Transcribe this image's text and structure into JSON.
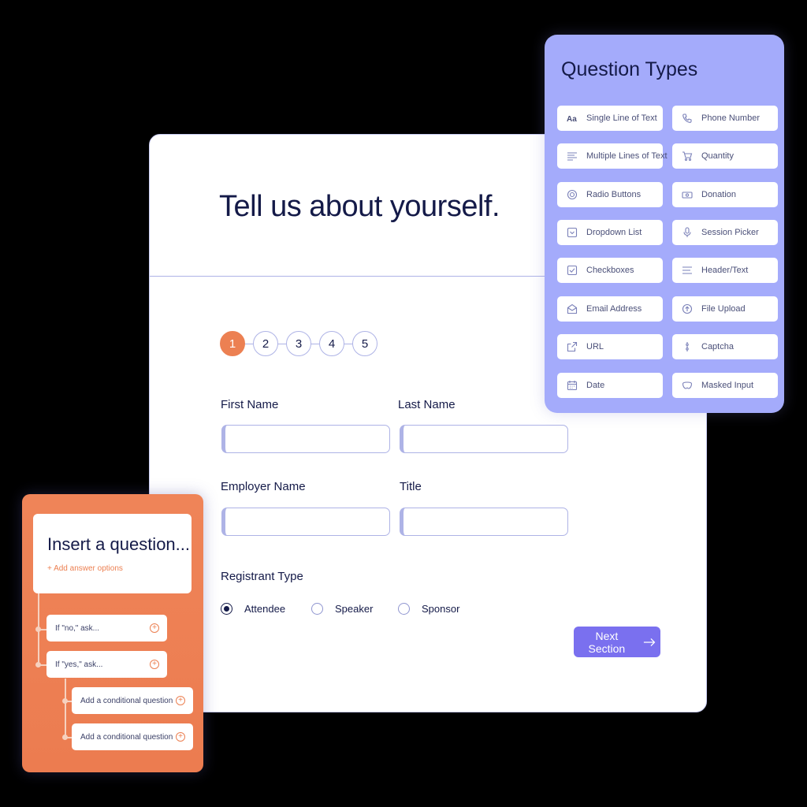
{
  "form": {
    "title": "Tell us about yourself.",
    "steps": [
      "1",
      "2",
      "3",
      "4",
      "5"
    ],
    "active_step": "1",
    "fields": {
      "first_name_label": "First Name",
      "last_name_label": "Last Name",
      "employer_name_label": "Employer Name",
      "title_label": "Title"
    },
    "registrant_type": {
      "label": "Registrant Type",
      "options": [
        "Attendee",
        "Speaker",
        "Sponsor"
      ],
      "selected": "Attendee"
    },
    "next_button_label": "Next Section",
    "colors": {
      "accent": "#7a70ef",
      "active_step": "#ec8052",
      "border": "#aeb3e6",
      "text": "#141a48"
    }
  },
  "question_types": {
    "title": "Question Types",
    "items": [
      {
        "label": "Single Line of Text",
        "icon": "text-aa-icon"
      },
      {
        "label": "Phone Number",
        "icon": "phone-icon"
      },
      {
        "label": "Multiple Lines of Text",
        "icon": "lines-icon"
      },
      {
        "label": "Quantity",
        "icon": "cart-icon"
      },
      {
        "label": "Radio Buttons",
        "icon": "radio-icon"
      },
      {
        "label": "Donation",
        "icon": "donation-icon"
      },
      {
        "label": "Dropdown List",
        "icon": "dropdown-icon"
      },
      {
        "label": "Session Picker",
        "icon": "microphone-icon"
      },
      {
        "label": "Checkboxes",
        "icon": "checkbox-icon"
      },
      {
        "label": "Header/Text",
        "icon": "header-text-icon"
      },
      {
        "label": "Email Address",
        "icon": "email-icon"
      },
      {
        "label": "File Upload",
        "icon": "upload-icon"
      },
      {
        "label": "URL",
        "icon": "link-icon"
      },
      {
        "label": "Captcha",
        "icon": "captcha-icon"
      },
      {
        "label": "Date",
        "icon": "calendar-icon"
      },
      {
        "label": "Masked Input",
        "icon": "mask-icon"
      }
    ],
    "colors": {
      "panel": "#a4abfb"
    }
  },
  "insert_question": {
    "title": "Insert a question...",
    "add_answer_options": "+ Add answer options",
    "branches": [
      {
        "label": "If \"no,\" ask..."
      },
      {
        "label": "If \"yes,\" ask..."
      }
    ],
    "conditional": [
      {
        "label": "Add a conditional question"
      },
      {
        "label": "Add a conditional question"
      }
    ],
    "colors": {
      "panel": "#ec7c50"
    }
  }
}
